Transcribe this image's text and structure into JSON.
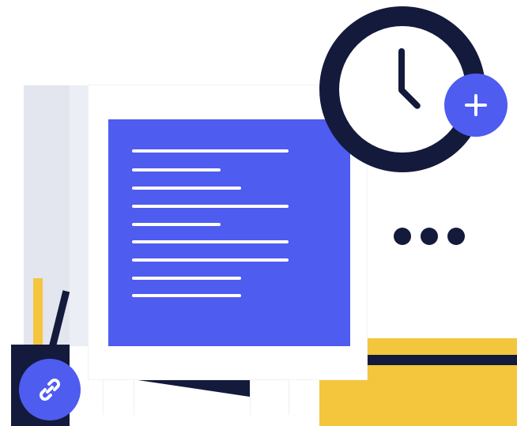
{
  "icons": {
    "clock": "clock-icon",
    "add": "plus-icon",
    "more": "more-dots-icon",
    "link": "link-icon"
  },
  "colors": {
    "accent_blue": "#4e5cf0",
    "navy": "#141a3b",
    "yellow": "#f4c63d",
    "panel_gray": "#e3e5ef",
    "background": "#ffffff"
  },
  "document": {
    "text_line_count": 9
  }
}
